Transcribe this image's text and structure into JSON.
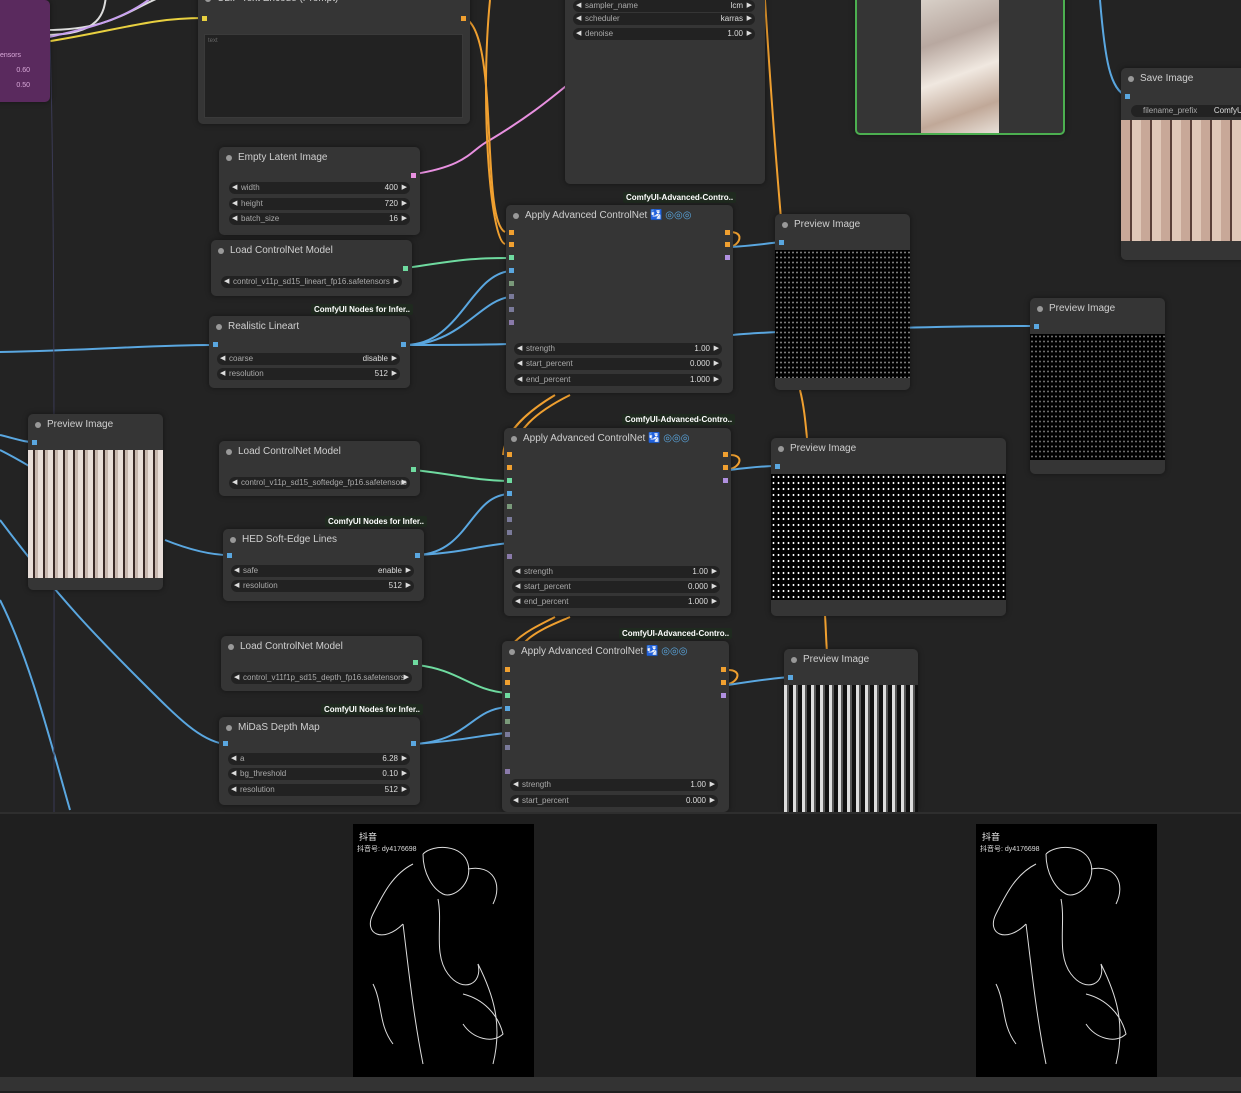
{
  "nodes": {
    "clip_text": {
      "title": "CLIP Text Encode (Prompt)",
      "placeholder": "text"
    },
    "sampler": {
      "sampler_name_label": "sampler_name",
      "sampler_name_value": "lcm",
      "scheduler_label": "scheduler",
      "scheduler_value": "karras",
      "denoise_label": "denoise",
      "denoise_value": "1.00"
    },
    "lora_partial": {
      "label": "ensors",
      "v1": "0.60",
      "v2": "0.50"
    },
    "empty_latent": {
      "title": "Empty Latent Image",
      "width_label": "width",
      "width_value": "400",
      "height_label": "height",
      "height_value": "720",
      "batch_label": "batch_size",
      "batch_value": "16"
    },
    "cn_loader_1": {
      "title": "Load ControlNet Model",
      "value": "control_v11p_sd15_lineart_fp16.safetensors"
    },
    "lineart": {
      "tag": "ComfyUI Nodes for Infer..",
      "title": "Realistic Lineart",
      "coarse_label": "coarse",
      "coarse_value": "disable",
      "res_label": "resolution",
      "res_value": "512"
    },
    "apply_cn_1": {
      "tag": "ComfyUI-Advanced-Contro..",
      "title": "Apply Advanced ControlNet",
      "strength_label": "strength",
      "strength_value": "1.00",
      "start_label": "start_percent",
      "start_value": "0.000",
      "end_label": "end_percent",
      "end_value": "1.000"
    },
    "preview_1": {
      "title": "Preview Image"
    },
    "preview_2": {
      "title": "Preview Image"
    },
    "save_image": {
      "title": "Save Image",
      "prefix_label": "filename_prefix",
      "prefix_value": "ComfyUI"
    },
    "preview_left": {
      "title": "Preview Image"
    },
    "cn_loader_2": {
      "title": "Load ControlNet Model",
      "value": "control_v11p_sd15_softedge_fp16.safetensors"
    },
    "hed": {
      "tag": "ComfyUI Nodes for Infer..",
      "title": "HED Soft-Edge Lines",
      "safe_label": "safe",
      "safe_value": "enable",
      "res_label": "resolution",
      "res_value": "512"
    },
    "apply_cn_2": {
      "tag": "ComfyUI-Advanced-Contro..",
      "title": "Apply Advanced ControlNet",
      "strength_label": "strength",
      "strength_value": "1.00",
      "start_label": "start_percent",
      "start_value": "0.000",
      "end_label": "end_percent",
      "end_value": "1.000"
    },
    "preview_3": {
      "title": "Preview Image"
    },
    "cn_loader_3": {
      "title": "Load ControlNet Model",
      "value": "control_v11f1p_sd15_depth_fp16.safetensors"
    },
    "midas": {
      "tag": "ComfyUI Nodes for Infer..",
      "title": "MiDaS Depth Map",
      "a_label": "a",
      "a_value": "6.28",
      "bg_label": "bg_threshold",
      "bg_value": "0.10",
      "res_label": "resolution",
      "res_value": "512"
    },
    "apply_cn_3": {
      "tag": "ComfyUI-Advanced-Contro..",
      "title": "Apply Advanced ControlNet",
      "strength_label": "strength",
      "strength_value": "1.00",
      "start_label": "start_percent",
      "start_value": "0.000"
    },
    "preview_4": {
      "title": "Preview Image"
    }
  },
  "bottom_panel": {
    "watermark_1": "抖音",
    "id_1": "抖音号: dy4176698",
    "watermark_2": "抖音",
    "id_2": "抖音号: dy4176698"
  },
  "colors": {
    "canvas": "#232323",
    "node": "#353535",
    "wire_blue": "#5aa7e0",
    "wire_orange": "#f0a030",
    "wire_green": "#6fdba0",
    "wire_pink": "#e890e0",
    "wire_yellow": "#e8d040",
    "wire_purple": "#b090e0",
    "selected_border": "#4caf50"
  }
}
